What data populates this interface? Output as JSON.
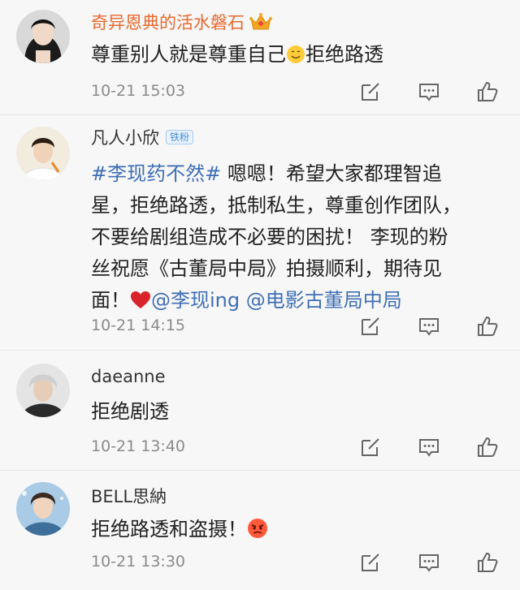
{
  "comments": [
    {
      "username": "奇异恩典的活水磐石",
      "badge": "",
      "segments": [
        {
          "type": "text",
          "text": "尊重别人就是尊重自己"
        },
        {
          "type": "emoji",
          "name": "smile-emoji"
        },
        {
          "type": "text",
          "text": "拒绝路透"
        }
      ],
      "time": "10-21 15:03"
    },
    {
      "username": "凡人小欣",
      "badge": "铁粉",
      "text_hashtag": "#李现药不然#",
      "text_body_1": " 嗯嗯！希望大家都理智追",
      "text_line_2": "星，拒绝路透，抵制私生，尊重创作团队，",
      "text_line_3": "不要给剧组造成不必要的困扰！ 李现的粉",
      "text_line_4": "丝祝愿《古董局中局》拍摄顺利，期待见",
      "text_line_5_a": "面！",
      "mention_1": "@李现ing",
      "mention_2": "@电影古董局中局",
      "time": "10-21 14:15"
    },
    {
      "username": "daeanne",
      "text": "拒绝剧透",
      "time": "10-21 13:40"
    },
    {
      "username": "BELL思納",
      "text": "拒绝路透和盗摄！",
      "time": "10-21 13:30"
    }
  ],
  "icons": {
    "edit": "edit-icon",
    "comment": "comment-icon",
    "like": "thumbs-up-icon",
    "crown": "crown-icon",
    "heart": "red-heart-emoji",
    "angry": "angry-face-emoji",
    "smile": "smile-emoji"
  },
  "colors": {
    "vip_name": "#e8692f",
    "link": "#3f6fb4",
    "time": "#8a8a8a"
  }
}
